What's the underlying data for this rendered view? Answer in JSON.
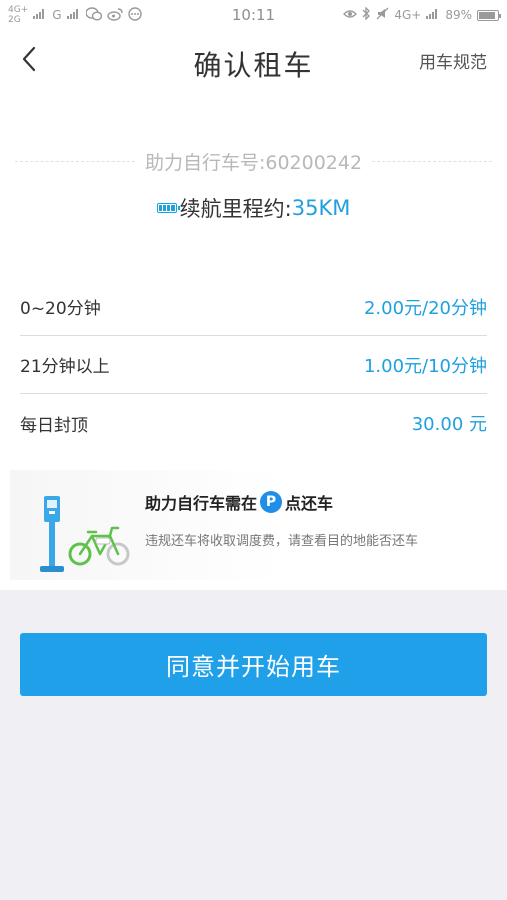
{
  "status_bar": {
    "network_top": "4G+",
    "network_bottom": "2G",
    "network_g": "G",
    "time": "10:11",
    "network_right": "4G+",
    "battery_text": "89%",
    "battery_level": 0.89
  },
  "header": {
    "title": "确认租车",
    "rules_link": "用车规范"
  },
  "bike": {
    "number": "助力自行车号:60200242",
    "range_label": "续航里程约:",
    "range_value": "35KM"
  },
  "pricing": {
    "rows": [
      {
        "label": "0~20分钟",
        "value": "2.00元/20分钟"
      },
      {
        "label": "21分钟以上",
        "value": "1.00元/10分钟"
      },
      {
        "label": "每日封顶",
        "value": "30.00 元"
      }
    ]
  },
  "notice": {
    "title_before": "助力自行车需在",
    "p_glyph": "P",
    "title_after": "点还车",
    "subtitle": "违规还车将收取调度费，请查看目的地能否还车"
  },
  "actions": {
    "start_button": "同意并开始用车"
  },
  "colors": {
    "accent": "#1fa0e8",
    "background": "#efeff4"
  }
}
